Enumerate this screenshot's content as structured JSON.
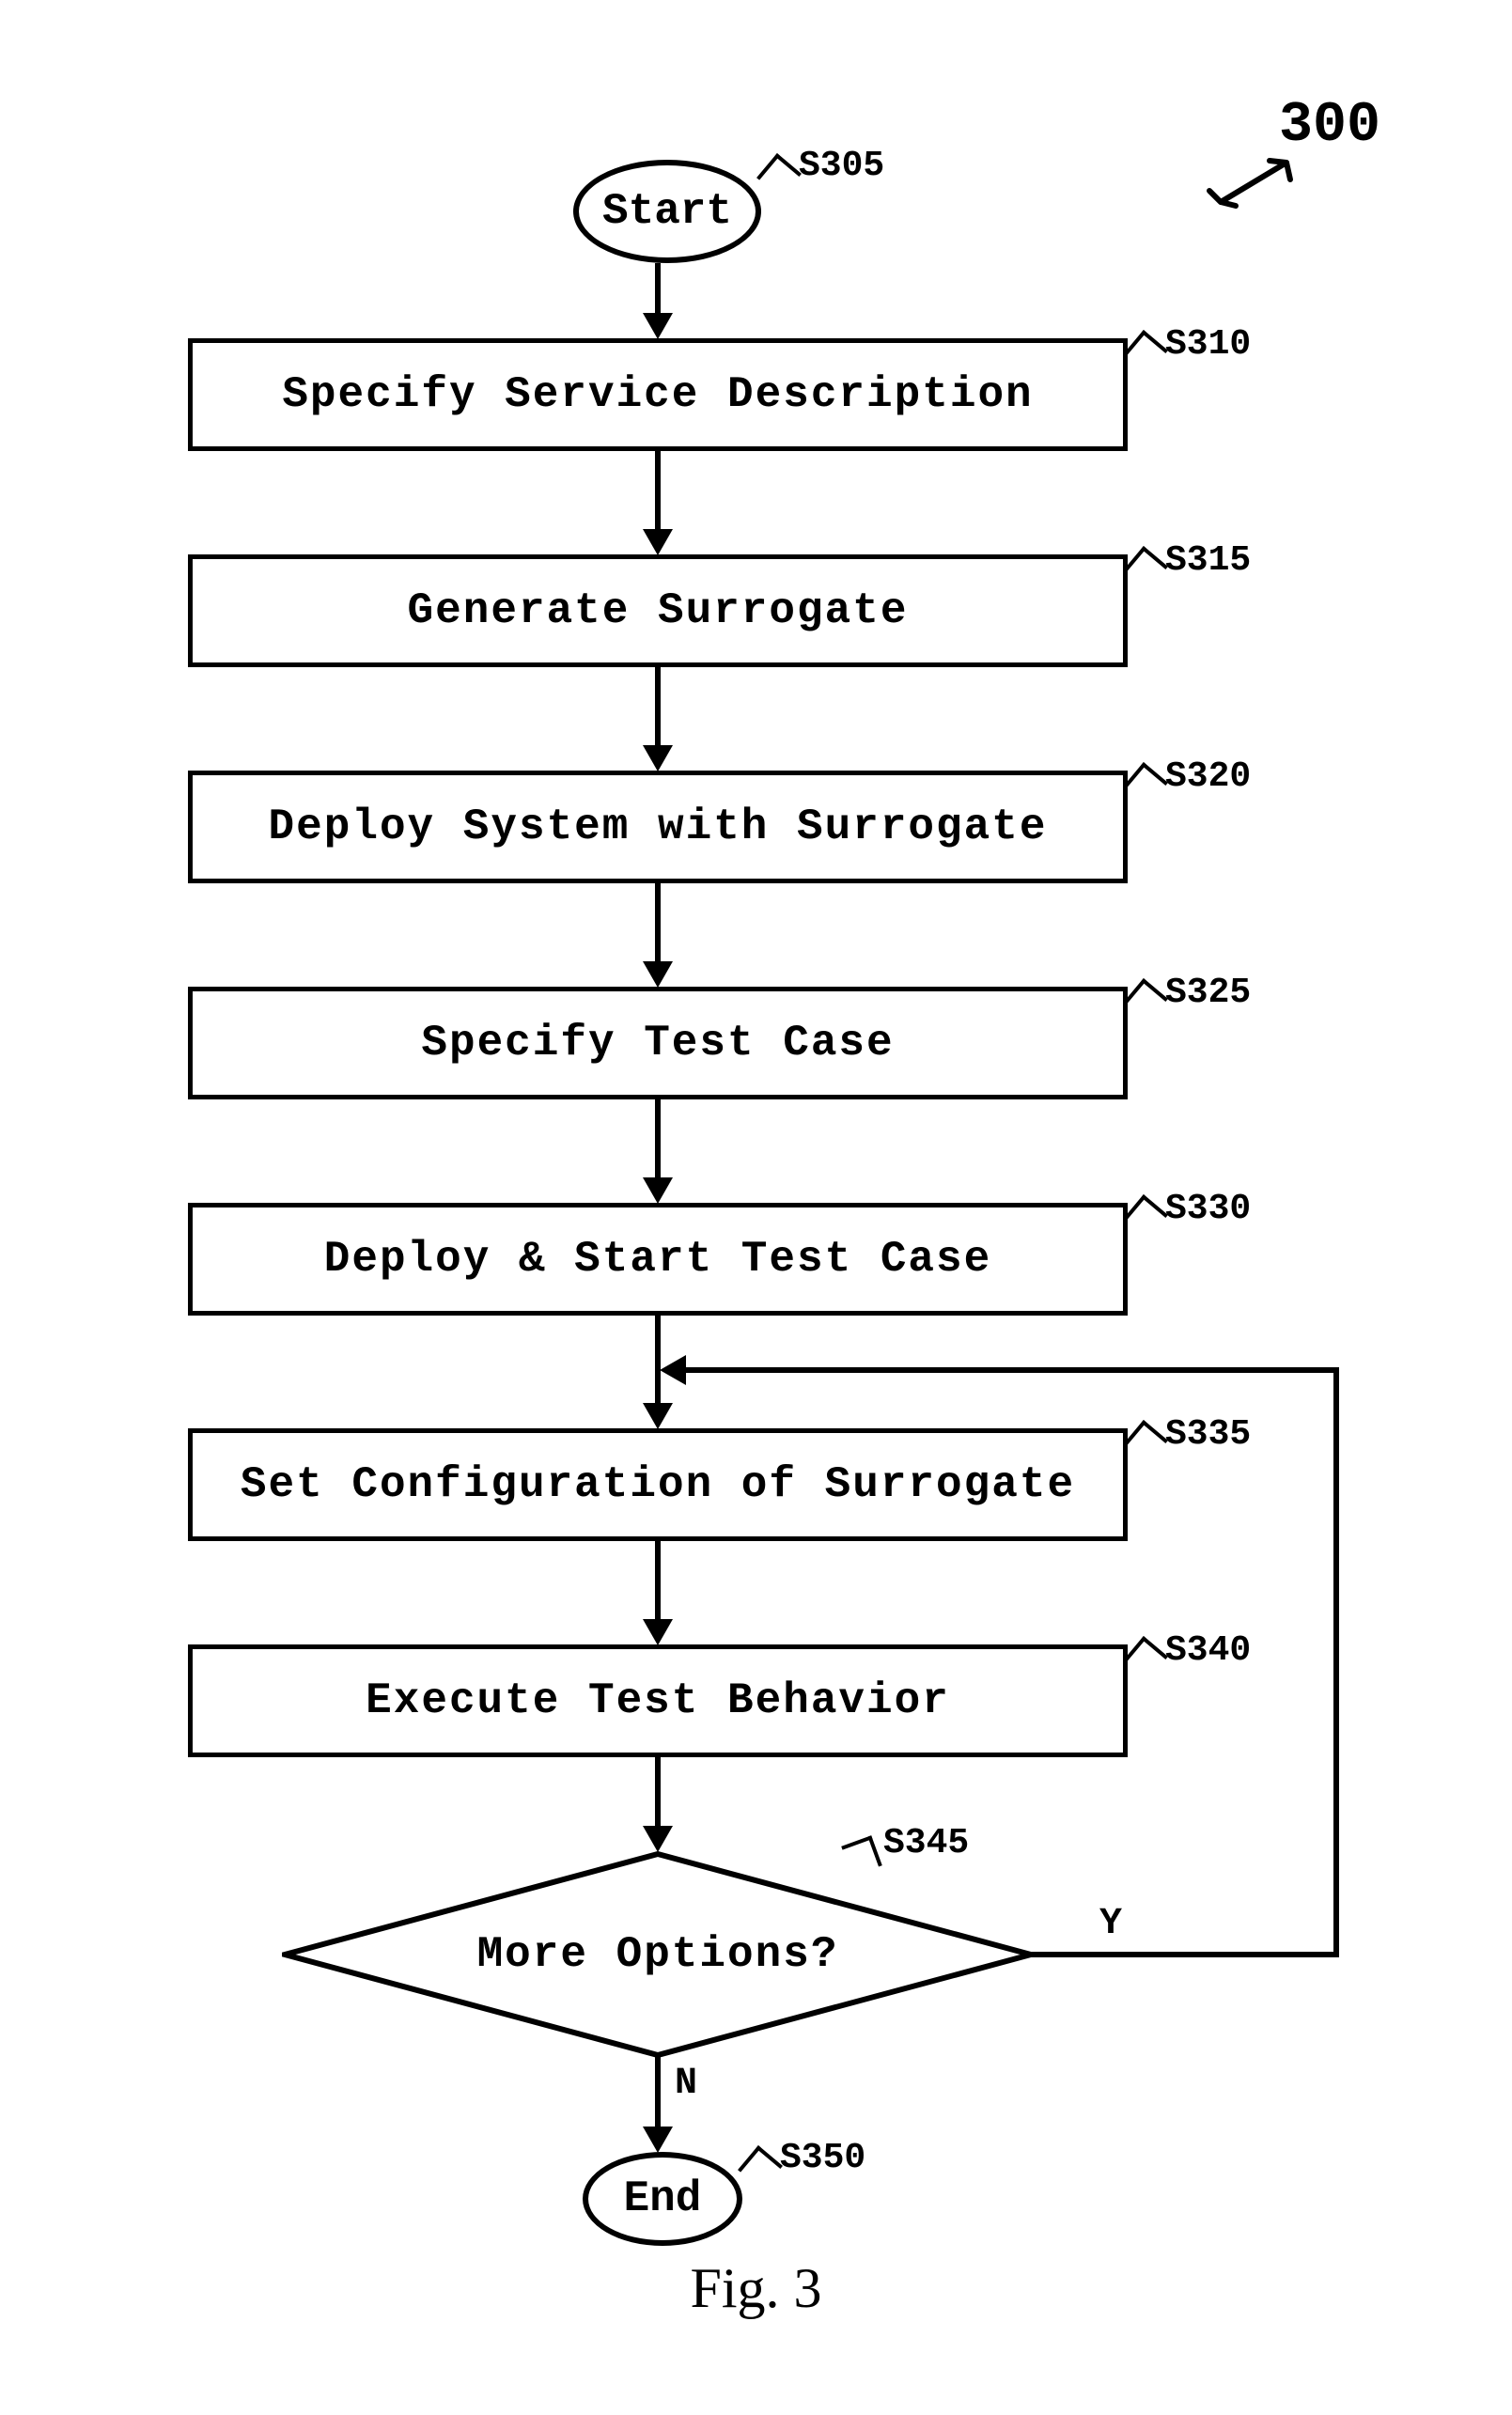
{
  "figure": {
    "number": "300",
    "caption": "Fig. 3"
  },
  "nodes": {
    "start": {
      "label": "S305",
      "text": "Start"
    },
    "specSvc": {
      "label": "S310",
      "text": "Specify Service Description"
    },
    "genSur": {
      "label": "S315",
      "text": "Generate Surrogate"
    },
    "deploySys": {
      "label": "S320",
      "text": "Deploy System with Surrogate"
    },
    "specTest": {
      "label": "S325",
      "text": "Specify Test Case"
    },
    "deployTest": {
      "label": "S330",
      "text": "Deploy & Start Test Case"
    },
    "setConf": {
      "label": "S335",
      "text": "Set Configuration of Surrogate"
    },
    "execBeh": {
      "label": "S340",
      "text": "Execute Test Behavior"
    },
    "moreOpt": {
      "label": "S345",
      "text": "More Options?"
    },
    "end": {
      "label": "S350",
      "text": "End"
    }
  },
  "edges": {
    "yes": "Y",
    "no": "N"
  }
}
